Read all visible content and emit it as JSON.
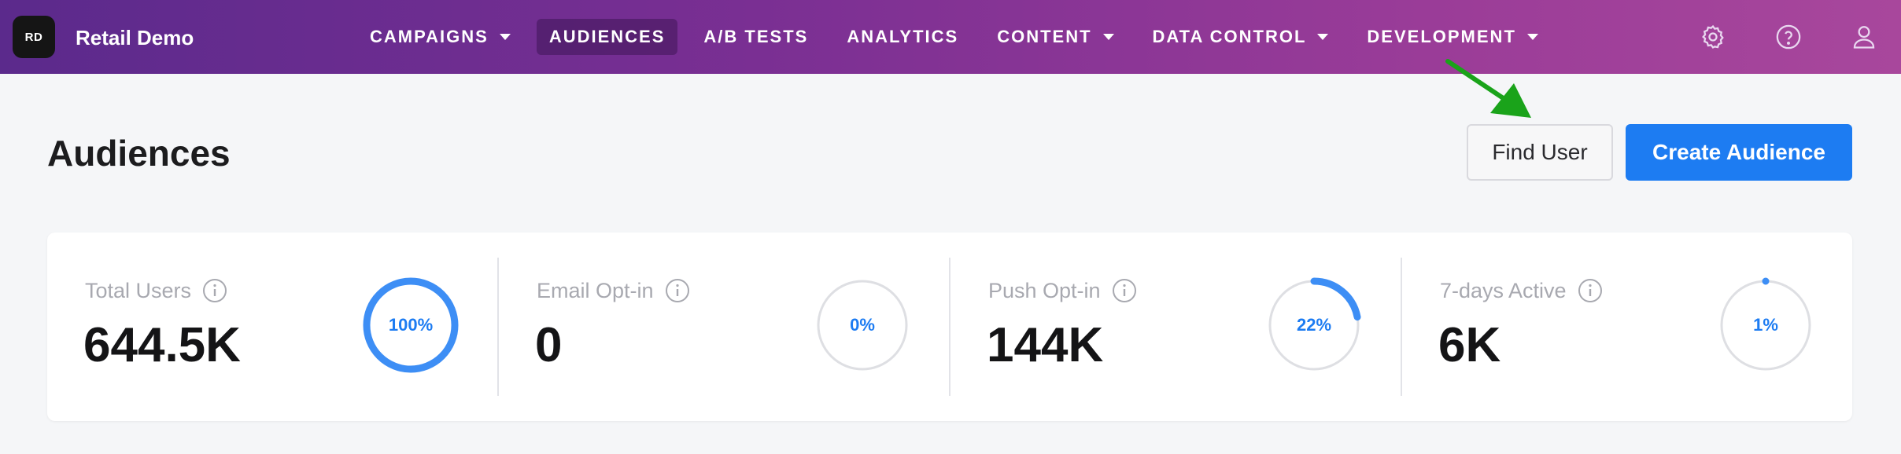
{
  "app": {
    "badge": "RD",
    "name": "Retail Demo"
  },
  "nav": [
    {
      "label": "CAMPAIGNS",
      "dropdown": true,
      "active": false
    },
    {
      "label": "AUDIENCES",
      "dropdown": false,
      "active": true
    },
    {
      "label": "A/B TESTS",
      "dropdown": false,
      "active": false
    },
    {
      "label": "ANALYTICS",
      "dropdown": false,
      "active": false
    },
    {
      "label": "CONTENT",
      "dropdown": true,
      "active": false
    },
    {
      "label": "DATA CONTROL",
      "dropdown": true,
      "active": false
    },
    {
      "label": "DEVELOPMENT",
      "dropdown": true,
      "active": false
    }
  ],
  "top_icons": [
    "gear-icon",
    "help-icon",
    "user-icon"
  ],
  "page": {
    "title": "Audiences",
    "find_user_label": "Find User",
    "create_audience_label": "Create Audience"
  },
  "stats": [
    {
      "label": "Total Users",
      "value": "644.5K",
      "percent_label": "100%",
      "percent": 100
    },
    {
      "label": "Email Opt-in",
      "value": "0",
      "percent_label": "0%",
      "percent": 0
    },
    {
      "label": "Push Opt-in",
      "value": "144K",
      "percent_label": "22%",
      "percent": 22
    },
    {
      "label": "7-days Active",
      "value": "6K",
      "percent_label": "1%",
      "percent": 1
    }
  ],
  "colors": {
    "accent": "#1d7cf2",
    "ring_track": "#dedfe3",
    "annotation_arrow": "#1aa31a"
  }
}
